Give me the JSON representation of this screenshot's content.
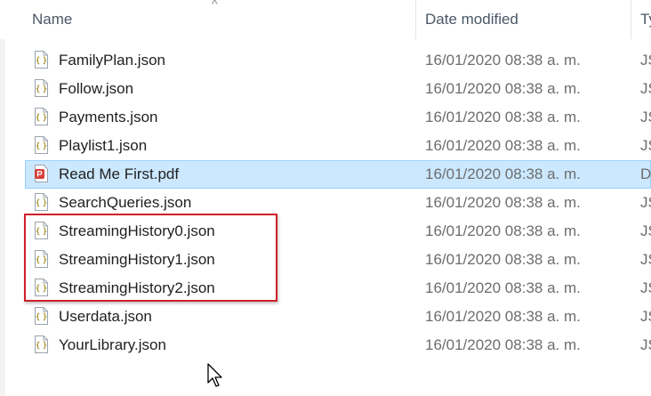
{
  "header": {
    "name_label": "Name",
    "date_label": "Date modified",
    "type_label": "Ty"
  },
  "files": [
    {
      "name": "FamilyPlan.json",
      "date": "16/01/2020 08:38 a. m.",
      "type": "JS",
      "icon": "json-file-icon"
    },
    {
      "name": "Follow.json",
      "date": "16/01/2020 08:38 a. m.",
      "type": "JS",
      "icon": "json-file-icon"
    },
    {
      "name": "Payments.json",
      "date": "16/01/2020 08:38 a. m.",
      "type": "JS",
      "icon": "json-file-icon"
    },
    {
      "name": "Playlist1.json",
      "date": "16/01/2020 08:38 a. m.",
      "type": "JS",
      "icon": "json-file-icon"
    },
    {
      "name": "Read Me First.pdf",
      "date": "16/01/2020 08:38 a. m.",
      "type": "D",
      "icon": "pdf-file-icon",
      "selected": true
    },
    {
      "name": "SearchQueries.json",
      "date": "16/01/2020 08:38 a. m.",
      "type": "JS",
      "icon": "json-file-icon"
    },
    {
      "name": "StreamingHistory0.json",
      "date": "16/01/2020 08:38 a. m.",
      "type": "JS",
      "icon": "json-file-icon"
    },
    {
      "name": "StreamingHistory1.json",
      "date": "16/01/2020 08:38 a. m.",
      "type": "JS",
      "icon": "json-file-icon"
    },
    {
      "name": "StreamingHistory2.json",
      "date": "16/01/2020 08:38 a. m.",
      "type": "JS",
      "icon": "json-file-icon"
    },
    {
      "name": "Userdata.json",
      "date": "16/01/2020 08:38 a. m.",
      "type": "JS",
      "icon": "json-file-icon"
    },
    {
      "name": "YourLibrary.json",
      "date": "16/01/2020 08:38 a. m.",
      "type": "JS",
      "icon": "json-file-icon"
    }
  ],
  "colors": {
    "selection": "#cce8ff",
    "selection_border": "#99d1ff",
    "highlight": "#d01f29"
  }
}
